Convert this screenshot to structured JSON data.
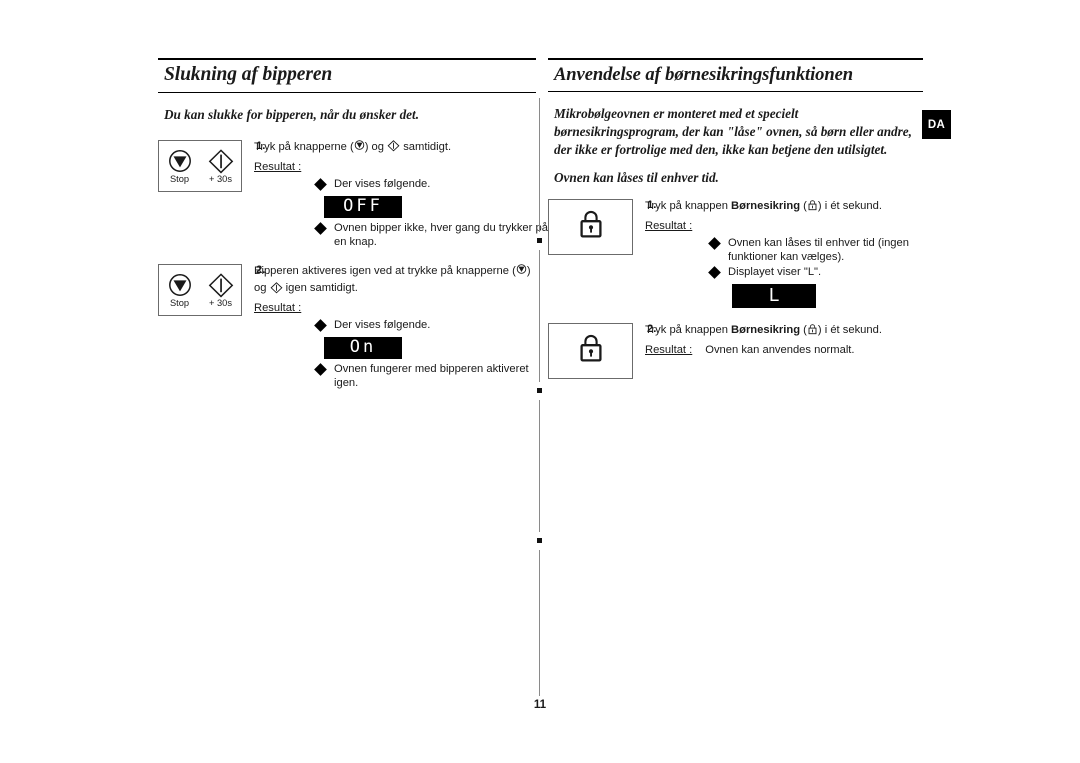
{
  "page": {
    "number": "11",
    "language_badge": "DA"
  },
  "left_column": {
    "heading": "Slukning af bipperen",
    "intro": "Du kan slukke for bipperen, når du ønsker det.",
    "steps": [
      {
        "number": "1.",
        "keys": [
          {
            "label": "Stop",
            "icon": "stop-button-icon"
          },
          {
            "label": "+ 30s",
            "icon": "plus-30s-button-icon"
          }
        ],
        "instruction_prefix": "Tryk på knapperne (",
        "instruction_mid": ") og",
        "instruction_suffix": "samtidigt.",
        "result_label": "Resultat :",
        "bullets": [
          {
            "text": "Der vises følgende."
          },
          {
            "text": "Ovnen bipper ikke, hver gang du trykker på en knap."
          }
        ],
        "display": "OFF"
      },
      {
        "number": "2.",
        "keys": [
          {
            "label": "Stop",
            "icon": "stop-button-icon"
          },
          {
            "label": "+ 30s",
            "icon": "plus-30s-button-icon"
          }
        ],
        "instruction_prefix": "Bipperen aktiveres igen ved at trykke på knapperne (",
        "instruction_mid": ")",
        "instruction_line2_prefix": "og",
        "instruction_line2_suffix": "igen samtidigt.",
        "result_label": "Resultat :",
        "bullets": [
          {
            "text": "Der vises følgende."
          },
          {
            "text": "Ovnen fungerer med bipperen aktiveret igen."
          }
        ],
        "display": "On"
      }
    ]
  },
  "right_column": {
    "heading": "Anvendelse af børnesikringsfunktionen",
    "intro": "Mikrobølgeovnen er monteret med et specielt børnesikringsprogram, der kan \"låse\" ovnen, så børn eller andre, der ikke er fortrolige med den, ikke kan betjene den utilsigtet.",
    "intro2": "Ovnen kan låses til enhver tid.",
    "steps": [
      {
        "number": "1.",
        "key_icon": "child-lock-button-icon",
        "instruction_prefix": "Tryk på knappen",
        "instruction_bold": "Børnesikring",
        "instruction_suffix": ") i ét sekund.",
        "result_label": "Resultat :",
        "bullets": [
          {
            "text": "Ovnen kan låses til enhver tid (ingen funktioner kan vælges)."
          },
          {
            "text": "Displayet viser \"L\"."
          }
        ],
        "display": "L"
      },
      {
        "number": "2.",
        "key_icon": "child-lock-button-icon",
        "instruction_prefix": "Tryk på knappen",
        "instruction_bold": "Børnesikring",
        "instruction_suffix": ") i ét sekund.",
        "result_label": "Resultat :",
        "result_value": "Ovnen kan anvendes normalt."
      }
    ]
  }
}
